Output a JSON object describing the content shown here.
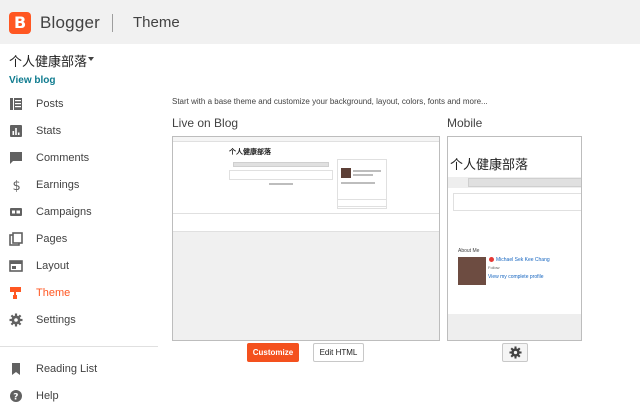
{
  "header": {
    "brand": "Blogger",
    "section": "Theme"
  },
  "sidebar": {
    "blog_name": "个人健康部落",
    "view_blog": "View blog",
    "items": [
      {
        "label": "Posts",
        "icon": "posts-icon"
      },
      {
        "label": "Stats",
        "icon": "stats-icon"
      },
      {
        "label": "Comments",
        "icon": "comments-icon"
      },
      {
        "label": "Earnings",
        "icon": "dollar-icon"
      },
      {
        "label": "Campaigns",
        "icon": "campaigns-icon"
      },
      {
        "label": "Pages",
        "icon": "pages-icon"
      },
      {
        "label": "Layout",
        "icon": "layout-icon"
      },
      {
        "label": "Theme",
        "icon": "theme-icon",
        "active": true
      },
      {
        "label": "Settings",
        "icon": "gear-icon"
      }
    ],
    "secondary": [
      {
        "label": "Reading List",
        "icon": "bookmark-icon"
      },
      {
        "label": "Help",
        "icon": "help-icon"
      }
    ]
  },
  "main": {
    "intro": "Start with a base theme and customize your background, layout, colors, fonts and more...",
    "live_label": "Live on Blog",
    "mobile_label": "Mobile",
    "preview_title": "个人健康部落",
    "mobile_title": "个人健康部落",
    "mobile_about": "About Me",
    "mobile_author": "Michael Sek Kee Chang",
    "mobile_follow": "Follow",
    "mobile_profile_link": "View my complete profile",
    "customize_label": "Customize",
    "edit_html_label": "Edit HTML"
  },
  "colors": {
    "accent": "#ff5722",
    "customize_button": "#f4511e",
    "link": "#0f7b8f"
  }
}
